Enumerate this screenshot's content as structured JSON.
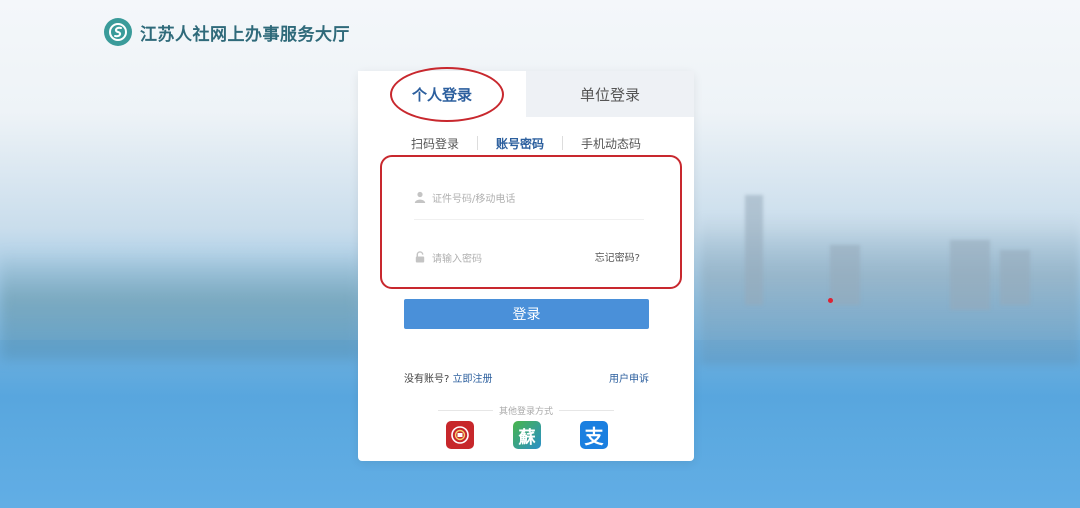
{
  "header": {
    "site_title": "江苏人社网上办事服务大厅",
    "logo_icon": "swirl-logo-icon"
  },
  "tabs": {
    "personal": "个人登录",
    "unit": "单位登录"
  },
  "sub_tabs": {
    "scan": "扫码登录",
    "account": "账号密码",
    "sms": "手机动态码"
  },
  "form": {
    "id_placeholder": "证件号码/移动电话",
    "password_placeholder": "请输入密码",
    "forgot": "忘记密码?"
  },
  "login_button": "登录",
  "register": {
    "prompt": "没有账号?",
    "link": "立即注册"
  },
  "appeal": "用户申诉",
  "other_login": "其他登录方式",
  "other_icons": [
    "red-emblem-icon",
    "su-app-icon",
    "alipay-icon"
  ],
  "colors": {
    "accent": "#4a90d9",
    "link": "#2c5f9e",
    "annotation": "#c8282e"
  }
}
